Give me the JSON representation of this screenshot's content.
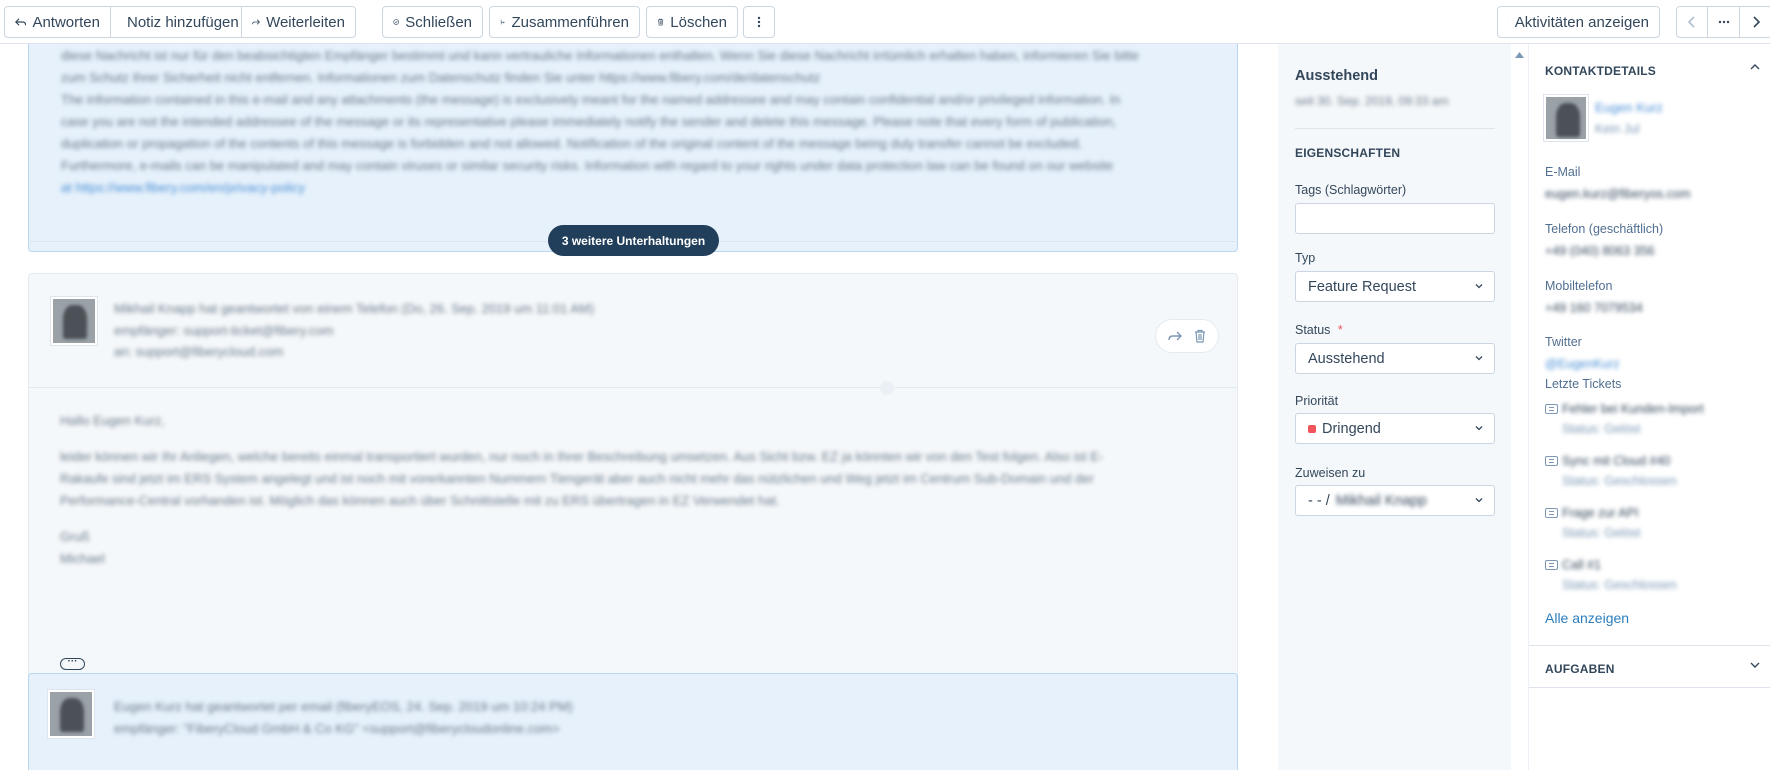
{
  "toolbar": {
    "reply": "Antworten",
    "add_note": "Notiz hinzufügen",
    "forward": "Weiterleiten",
    "close": "Schließen",
    "merge": "Zusammenführen",
    "delete": "Löschen",
    "show_activities": "Aktivitäten anzeigen"
  },
  "thread": {
    "top_email_lines": [
      "diese Nachricht ist nur für den beabsichtigten Empfänger bestimmt und kann vertrauliche Informationen enthalten. Wenn Sie diese Nachricht irrtümlich erhalten haben, informieren Sie bitte",
      "zum Schutz Ihrer Sicherheit nicht entfernen. Informationen zum Datenschutz finden Sie unter https://www.fibery.com/de/datenschutz",
      "The information contained in this e-mail and any attachments (the message) is exclusively meant for the named addressee and may contain confidential and/or privileged information. In",
      "case you are not the intended addressee of the message or its representative please immediately notify the sender and delete this message. Please note that every form of publication,",
      "duplication or propagation of the contents of this message is forbidden and not allowed. Notification of the original content of the message being duly transfer cannot be excluded.",
      "Furthermore, e-mails can be manipulated and may contain viruses or similar security risks. Information with regard to your rights under data protection law can be found on our website",
      "at https://www.fibery.com/en/privacy-policy"
    ],
    "more_conversations": "3 weitere Unterhaltungen",
    "msg1_header": [
      "Mikhail Knapp hat geantwortet von einem Telefon (Do, 26. Sep. 2019 um 11:01 AM)",
      "empfänger: support-ticket@fibery.com",
      "an: support@fiberycloud.com"
    ],
    "msg1_body": [
      "Hallo Eugen Kurz,",
      "",
      "leider können wir Ihr Anliegen, welche bereits einmal transportiert wurden, nur noch in Ihrer Beschreibung umsetzen. Aus Sicht bzw. EZ ja könnten wir von den Test folgen. Also ist E-",
      "Rakaufe sind jetzt im ERS System angelegt und ist noch mit vorerkannten Nummern Tiengerät aber auch nicht mehr das nützlichen und Weg jetzt im Centrum Sub-Domain und der",
      "Performance-Central vorhanden ist. Möglich das können auch über Schnittstelle mit zu ERS übertragen in EZ Verwendet hat.",
      "",
      "Gruß",
      "Michael"
    ],
    "msg2_header": [
      "Eugen Kurz hat geantwortet per email (fiberyEOS, 24. Sep. 2019 um 10:24 PM)",
      "empfänger: \"FiberyCloud GmbH & Co KG\" <support@fiberycloudonline.com>"
    ]
  },
  "properties": {
    "status_title": "Ausstehend",
    "status_since": "seit 30. Sep. 2019, 09:33 am",
    "section": "EIGENSCHAFTEN",
    "tags_label": "Tags (Schlagwörter)",
    "tags_value": "",
    "type_label": "Typ",
    "type_value": "Feature Request",
    "status_label": "Status",
    "status_required": "*",
    "status_value": "Ausstehend",
    "priority_label": "Priorität",
    "priority_value": "Dringend",
    "priority_color": "#f2545b",
    "assign_label": "Zuweisen zu",
    "assign_prefix": "- - /",
    "assign_value": "Mikhail Knapp"
  },
  "contact": {
    "section": "KONTAKTDETAILS",
    "name": "Eugen Kurz",
    "subtitle": "Kein Jul",
    "email_label": "E-Mail",
    "email_value": "eugen.kurz@fiberyos.com",
    "phone_label": "Telefon (geschäftlich)",
    "phone_value": "+49 (040) 8063 356",
    "mobile_label": "Mobiltelefon",
    "mobile_value": "+49 160 7079534",
    "twitter_label": "Twitter",
    "twitter_value": "@EugenKurz",
    "tickets_label": "Letzte Tickets",
    "tickets": [
      {
        "title": "Fehler bei Kunden-Import",
        "status": "Status: Gelöst"
      },
      {
        "title": "Sync mit Cloud #40",
        "status": "Status: Geschlossen"
      },
      {
        "title": "Frage zur API",
        "status": "Status: Gelöst"
      },
      {
        "title": "Call #1",
        "status": "Status: Geschlossen"
      }
    ],
    "show_all": "Alle anzeigen",
    "tasks_section": "AUFGABEN"
  }
}
